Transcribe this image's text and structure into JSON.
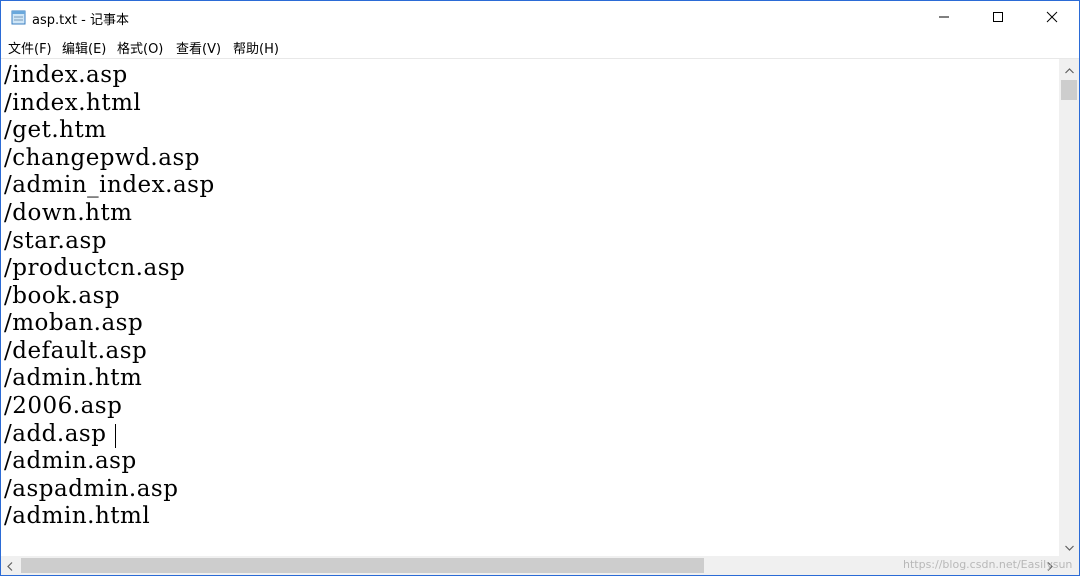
{
  "window": {
    "title": "asp.txt - 记事本",
    "icon": "notepad-icon"
  },
  "title_buttons": {
    "minimize_icon": "minimize-icon",
    "maximize_icon": "maximize-icon",
    "close_icon": "close-icon"
  },
  "menu": {
    "items": [
      {
        "label": "文件(F)"
      },
      {
        "label": "编辑(E)"
      },
      {
        "label": "格式(O)"
      },
      {
        "label": "查看(V)"
      },
      {
        "label": "帮助(H)"
      }
    ]
  },
  "editor": {
    "lines": [
      "/index.asp",
      "/index.html",
      "/get.htm",
      "/changepwd.asp",
      "/admin_index.asp",
      "/down.htm",
      "/star.asp",
      "/productcn.asp",
      "/book.asp",
      "/moban.asp",
      "/default.asp",
      "/admin.htm",
      "/2006.asp",
      "/add.asp",
      "/admin.asp",
      "/aspadmin.asp",
      "/admin.html"
    ]
  },
  "watermark": "https://blog.csdn.net/Easilysun"
}
